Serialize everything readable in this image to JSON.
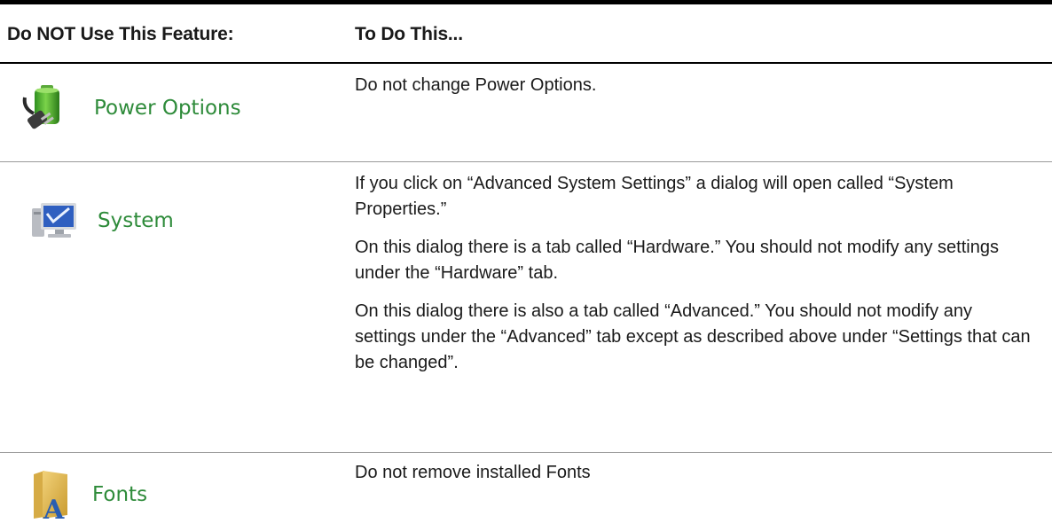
{
  "header": {
    "col_feature": "Do NOT Use This Feature:",
    "col_action": "To Do This..."
  },
  "rows": [
    {
      "feature": "Power Options",
      "icon": "power-options-icon",
      "paragraphs": [
        "Do not change Power Options."
      ]
    },
    {
      "feature": "System",
      "icon": "system-icon",
      "paragraphs": [
        "If you click on “Advanced System Settings” a dialog will open called “System Properties.”",
        "On this dialog there is a tab called “Hardware.” You should not modify any settings under the “Hardware” tab.",
        "On this dialog there is also a tab called “Advanced.” You should not modify any settings under the “Advanced” tab except as described above under “Settings that can be changed”."
      ]
    },
    {
      "feature": "Fonts",
      "icon": "fonts-folder-icon",
      "paragraphs": [
        "Do not remove installed Fonts"
      ]
    }
  ],
  "colors": {
    "feature_label": "#2e8b3a",
    "rule": "#000000",
    "row_separator": "#9a9a9a"
  }
}
